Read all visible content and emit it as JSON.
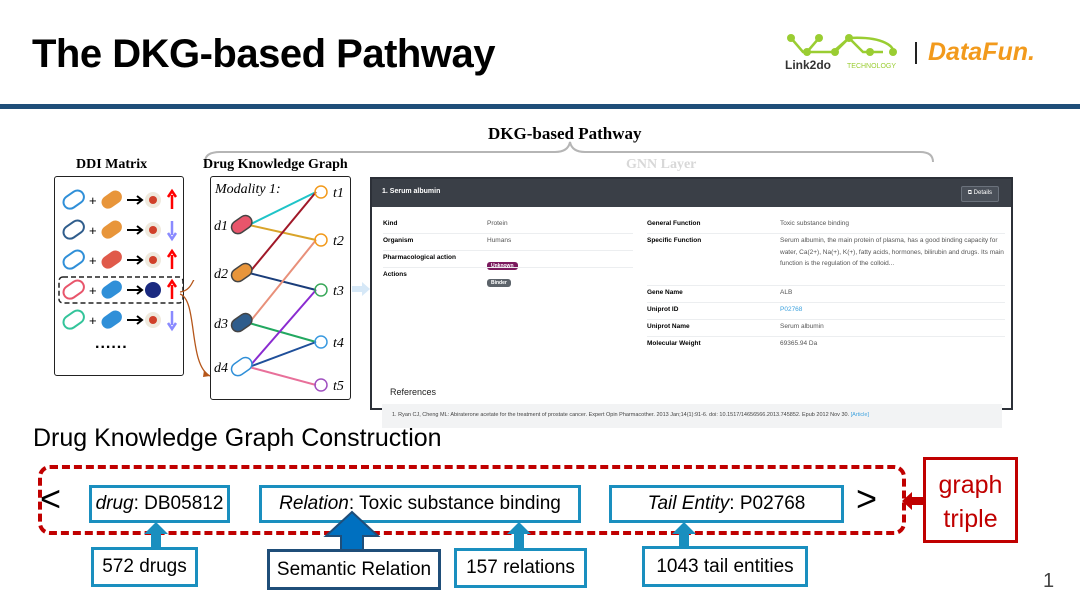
{
  "slide": {
    "title": "The DKG-based Pathway",
    "page_number": "1"
  },
  "logos": {
    "link2do": "Link2do",
    "link2do_sub": "TECHNOLOGY",
    "datafun": "DataFun."
  },
  "figure": {
    "pathway_label": "DKG-based Pathway",
    "gnn_label": "GNN Layer",
    "ddi": {
      "title": "DDI Matrix",
      "ellipsis": "......",
      "rows": [
        {
          "a": "#2f8fd8",
          "b": "#e8953a",
          "effect": "body-icon",
          "dir": "up"
        },
        {
          "a": "#2f5d8c",
          "b": "#e8953a",
          "effect": "thermometer-icon",
          "dir": "down"
        },
        {
          "a": "#2f8fd8",
          "b": "#e05a4a",
          "effect": "thermometer-icon",
          "dir": "up"
        },
        {
          "a": "#e8556b",
          "b": "#2f8fd8",
          "effect": "head-icon",
          "dir": "up"
        },
        {
          "a": "#33c49a",
          "b": "#2f8fd8",
          "effect": "body-icon",
          "dir": "down"
        }
      ]
    },
    "dkg": {
      "title": "Drug Knowledge Graph",
      "modality": "Modality 1:",
      "drugs": [
        "d1",
        "d2",
        "d3",
        "d4"
      ],
      "targets": [
        "t1",
        "t2",
        "t3",
        "t4",
        "t5"
      ],
      "edges": [
        {
          "from": 0,
          "to": 0,
          "color": "#1fc4c8"
        },
        {
          "from": 0,
          "to": 1,
          "color": "#d9a42a"
        },
        {
          "from": 1,
          "to": 0,
          "color": "#a01828"
        },
        {
          "from": 1,
          "to": 2,
          "color": "#1a3d7a"
        },
        {
          "from": 2,
          "to": 1,
          "color": "#e8907a"
        },
        {
          "from": 2,
          "to": 3,
          "color": "#22a860"
        },
        {
          "from": 3,
          "to": 2,
          "color": "#8a2bd0"
        },
        {
          "from": 3,
          "to": 3,
          "color": "#1f4f9a"
        },
        {
          "from": 3,
          "to": 4,
          "color": "#e8709a"
        }
      ]
    },
    "card": {
      "header": "1. Serum albumin",
      "details_button": "Details",
      "left": [
        {
          "key": "Kind",
          "value": "Protein"
        },
        {
          "key": "Organism",
          "value": "Humans"
        },
        {
          "key": "Pharmacological action",
          "badge": "Unknown",
          "badge_color": "#7b1a5e"
        },
        {
          "key": "Actions",
          "badge": "Binder",
          "badge_color": "#5c636a"
        }
      ],
      "right": [
        {
          "key": "General Function",
          "value": "Toxic substance binding"
        },
        {
          "key": "Specific Function",
          "value": "Serum albumin, the main protein of plasma, has a good binding capacity for water, Ca(2+), Na(+), K(+), fatty acids, hormones, bilirubin and drugs. Its main function is the regulation of the colloid..."
        },
        {
          "key": "Gene Name",
          "value": "ALB"
        },
        {
          "key": "Uniprot ID",
          "value": "P02768",
          "link": true
        },
        {
          "key": "Uniprot Name",
          "value": "Serum albumin"
        },
        {
          "key": "Molecular Weight",
          "value": "69365.94 Da"
        }
      ],
      "references_title": "References",
      "reference": "1. Ryan CJ, Cheng ML: Abiraterone acetate for the treatment of prostate cancer. Expert Opin Pharmacother. 2013 Jan;14(1):91-6. doi: 10.1517/14656566.2013.745852. Epub 2012 Nov 30.",
      "reference_link": "[Article]"
    }
  },
  "construction": {
    "heading": "Drug Knowledge Graph Construction",
    "open": "<",
    "close": ">",
    "drug": {
      "label": "drug",
      "value": ": DB05812"
    },
    "relation": {
      "label": "Relation",
      "value": ": Toxic substance binding"
    },
    "tail": {
      "label": "Tail Entity",
      "value": ": P02768"
    },
    "triple_label": [
      "graph",
      "triple"
    ],
    "counts": {
      "drugs": "572 drugs",
      "semantic": "Semantic Relation",
      "relations": "157 relations",
      "tails": "1043 tail entities"
    }
  }
}
